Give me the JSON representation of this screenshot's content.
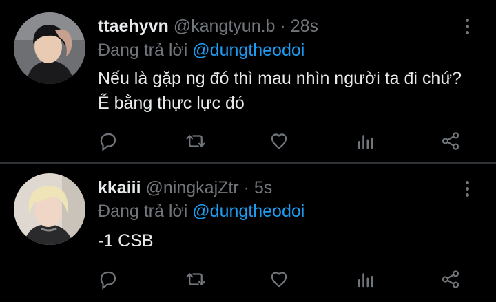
{
  "tweets": [
    {
      "name": "ttaehyvn",
      "handle": "@kangtyun.b",
      "separator": "·",
      "time": "28s",
      "reply_prefix": "Đang trả lời",
      "reply_to": "@dungtheodoi",
      "text": "Nếu là gặp ng đó thì mau nhìn người ta đi chứ? Ễ bằng thực lực đó"
    },
    {
      "name": "kkaiii",
      "handle": "@ningkajZtr",
      "separator": "·",
      "time": "5s",
      "reply_prefix": "Đang trả lời",
      "reply_to": "@dungtheodoi",
      "text": "-1 CSB"
    }
  ],
  "icons": {
    "more": "more-vertical-icon",
    "reply": "reply-icon",
    "retweet": "retweet-icon",
    "like": "heart-icon",
    "views": "views-icon",
    "share": "share-icon"
  },
  "colors": {
    "background": "#000000",
    "text": "#e7e9ea",
    "muted": "#71767b",
    "accent": "#1d9bf0",
    "divider": "#2f3336"
  }
}
